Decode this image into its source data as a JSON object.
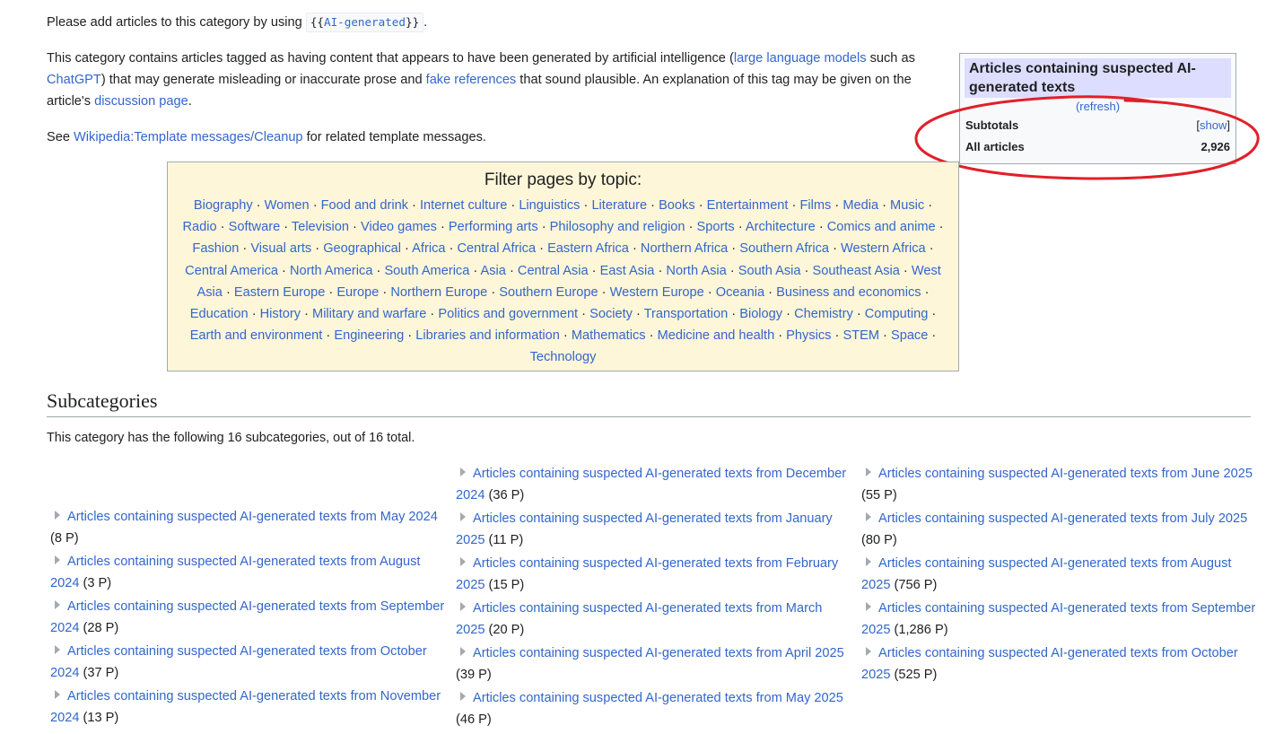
{
  "intro": {
    "prefix": "Please add articles to this category by using",
    "template_open": "{{",
    "template_name": "AI-generated",
    "template_close": "}}",
    "suffix": "."
  },
  "description": {
    "t1": "This category contains articles tagged as having content that appears to have been generated by artificial intelligence (",
    "l1": "large language models",
    "t2": " such as ",
    "l2": "ChatGPT",
    "t3": ") that may generate misleading or inaccurate prose and ",
    "l3": "fake references",
    "t4": " that sound plausible. An explanation of this tag may be given on the article's ",
    "l4": "discussion page",
    "t5": "."
  },
  "see_also": {
    "prefix": "See ",
    "link": "Wikipedia:Template messages/Cleanup",
    "suffix": " for related template messages."
  },
  "statbox": {
    "title": "Articles containing suspected AI-generated texts",
    "refresh": "(refresh)",
    "subtotals_label": "Subtotals",
    "show_open": "[",
    "show_label": "show",
    "show_close": "]",
    "all_label": "All articles",
    "all_value": "2,926"
  },
  "annotation": {
    "color": "#e0202a"
  },
  "filter": {
    "title": "Filter pages by topic:",
    "topics": [
      "Biography",
      "Women",
      "Food and drink",
      "Internet culture",
      "Linguistics",
      "Literature",
      "Books",
      "Entertainment",
      "Films",
      "Media",
      "Music",
      "Radio",
      "Software",
      "Television",
      "Video games",
      "Performing arts",
      "Philosophy and religion",
      "Sports",
      "Architecture",
      "Comics and anime",
      "Fashion",
      "Visual arts",
      "Geographical",
      "Africa",
      "Central Africa",
      "Eastern Africa",
      "Northern Africa",
      "Southern Africa",
      "Western Africa",
      "Central America",
      "North America",
      "South America",
      "Asia",
      "Central Asia",
      "East Asia",
      "North Asia",
      "South Asia",
      "Southeast Asia",
      "West Asia",
      "Eastern Europe",
      "Europe",
      "Northern Europe",
      "Southern Europe",
      "Western Europe",
      "Oceania",
      "Business and economics",
      "Education",
      "History",
      "Military and warfare",
      "Politics and government",
      "Society",
      "Transportation",
      "Biology",
      "Chemistry",
      "Computing",
      "Earth and environment",
      "Engineering",
      "Libraries and information",
      "Mathematics",
      "Medicine and health",
      "Physics",
      "STEM",
      "Space",
      "Technology"
    ],
    "separator": " · "
  },
  "subcategories": {
    "heading": "Subcategories",
    "count_text": "This category has the following 16 subcategories, out of 16 total.",
    "col1": [
      {
        "label": "Articles containing suspected AI-generated texts from May 2024",
        "count": "(8 P)"
      },
      {
        "label": "Articles containing suspected AI-generated texts from August 2024",
        "count": "(3 P)"
      },
      {
        "label": "Articles containing suspected AI-generated texts from September 2024",
        "count": "(28 P)"
      },
      {
        "label": "Articles containing suspected AI-generated texts from October 2024",
        "count": "(37 P)"
      },
      {
        "label": "Articles containing suspected AI-generated texts from November 2024",
        "count": "(13 P)"
      }
    ],
    "col2": [
      {
        "label": "Articles containing suspected AI-generated texts from December 2024",
        "count": "(36 P)"
      },
      {
        "label": "Articles containing suspected AI-generated texts from January 2025",
        "count": "(11 P)"
      },
      {
        "label": "Articles containing suspected AI-generated texts from February 2025",
        "count": "(15 P)"
      },
      {
        "label": "Articles containing suspected AI-generated texts from March 2025",
        "count": "(20 P)"
      },
      {
        "label": "Articles containing suspected AI-generated texts from April 2025",
        "count": "(39 P)"
      },
      {
        "label": "Articles containing suspected AI-generated texts from May 2025",
        "count": "(46 P)"
      }
    ],
    "col3": [
      {
        "label": "Articles containing suspected AI-generated texts from June 2025",
        "count": "(55 P)"
      },
      {
        "label": "Articles containing suspected AI-generated texts from July 2025",
        "count": "(80 P)"
      },
      {
        "label": "Articles containing suspected AI-generated texts from August 2025",
        "count": "(756 P)"
      },
      {
        "label": "Articles containing suspected AI-generated texts from September 2025",
        "count": "(1,286 P)"
      },
      {
        "label": "Articles containing suspected AI-generated texts from October 2025",
        "count": "(525 P)"
      }
    ]
  }
}
